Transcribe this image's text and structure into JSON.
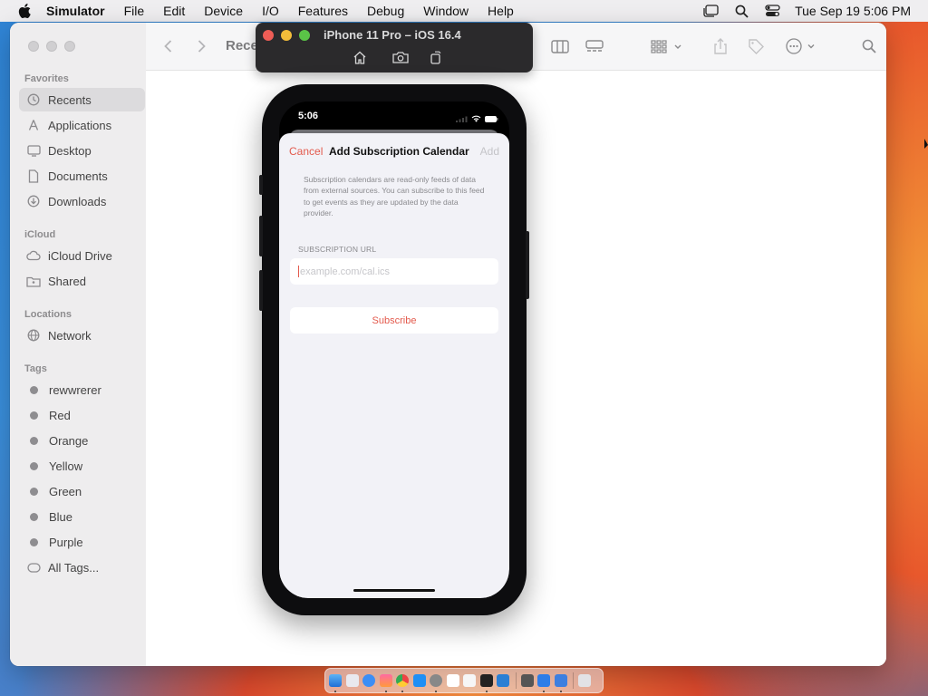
{
  "menubar": {
    "app": "Simulator",
    "menus": [
      "File",
      "Edit",
      "Device",
      "I/O",
      "Features",
      "Debug",
      "Window",
      "Help"
    ],
    "clock": "Tue Sep 19  5:06 PM"
  },
  "finder": {
    "toolbar_title": "Rece",
    "favorites": {
      "title": "Favorites",
      "items": [
        {
          "label": "Recents",
          "icon": "clock-icon"
        },
        {
          "label": "Applications",
          "icon": "applications-icon"
        },
        {
          "label": "Desktop",
          "icon": "desktop-icon"
        },
        {
          "label": "Documents",
          "icon": "document-icon"
        },
        {
          "label": "Downloads",
          "icon": "download-icon"
        }
      ]
    },
    "icloud": {
      "title": "iCloud",
      "items": [
        {
          "label": "iCloud Drive",
          "icon": "cloud-icon"
        },
        {
          "label": "Shared",
          "icon": "shared-folder-icon"
        }
      ]
    },
    "locations": {
      "title": "Locations",
      "items": [
        {
          "label": "Network",
          "icon": "globe-icon"
        }
      ]
    },
    "tags": {
      "title": "Tags",
      "items": [
        "rewwrerer",
        "Red",
        "Orange",
        "Yellow",
        "Green",
        "Blue",
        "Purple",
        "All Tags..."
      ]
    }
  },
  "simulator": {
    "title": "iPhone 11 Pro – iOS 16.4"
  },
  "phone": {
    "time": "5:06",
    "nav": {
      "cancel": "Cancel",
      "title": "Add Subscription Calendar",
      "add": "Add"
    },
    "description": "Subscription calendars are read-only feeds of data from external sources. You can subscribe to this feed to get events as they are updated by the data provider.",
    "url_label": "SUBSCRIPTION URL",
    "url_value": "",
    "url_placeholder": "example.com/cal.ics",
    "subscribe": "Subscribe"
  },
  "colors": {
    "accent": "#e35a4d",
    "sidebar_bg": "#eeedee",
    "sheet_bg": "#f2f2f7"
  }
}
